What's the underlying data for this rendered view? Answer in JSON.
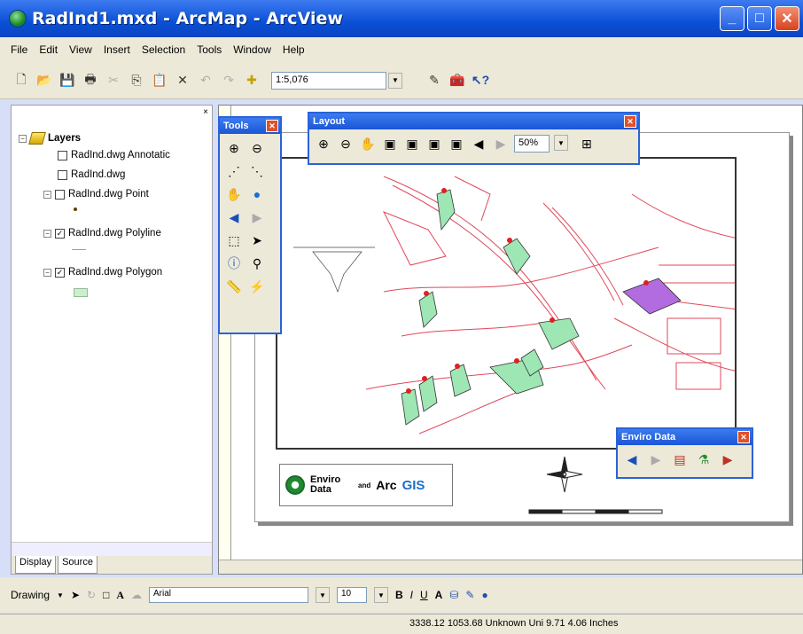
{
  "window": {
    "title": "RadInd1.mxd - ArcMap - ArcView"
  },
  "menu": {
    "items": [
      "File",
      "Edit",
      "View",
      "Insert",
      "Selection",
      "Tools",
      "Window",
      "Help"
    ]
  },
  "toolbar": {
    "scale_value": "1:5,076"
  },
  "toc": {
    "root_label": "Layers",
    "layers": [
      {
        "label": "RadInd.dwg Annotatic",
        "checked": false
      },
      {
        "label": "RadInd.dwg",
        "checked": false
      },
      {
        "label": "RadInd.dwg Point",
        "checked": false
      },
      {
        "label": "RadInd.dwg Polyline",
        "checked": true
      },
      {
        "label": "RadInd.dwg Polygon",
        "checked": true
      }
    ],
    "tabs": [
      "Display",
      "Source"
    ]
  },
  "tools_window": {
    "title": "Tools"
  },
  "layout_window": {
    "title": "Layout",
    "zoom": "50%"
  },
  "enviro_window": {
    "title": "Enviro Data"
  },
  "logo": {
    "enviro": "Enviro Data",
    "and": "and",
    "arc": "Arc",
    "gis": "GIS"
  },
  "drawing": {
    "label": "Drawing",
    "font": "Arial",
    "size": "10"
  },
  "status": {
    "coords": "3338.12  1053.68 Unknown Uni 9.71  4.06 Inches"
  },
  "colors": {
    "title_blue": "#0a4fd6",
    "chrome": "#ece9d8",
    "map_red": "#e0485a",
    "polygon_green": "#9ee6b4",
    "polygon_purple": "#b36be0"
  }
}
